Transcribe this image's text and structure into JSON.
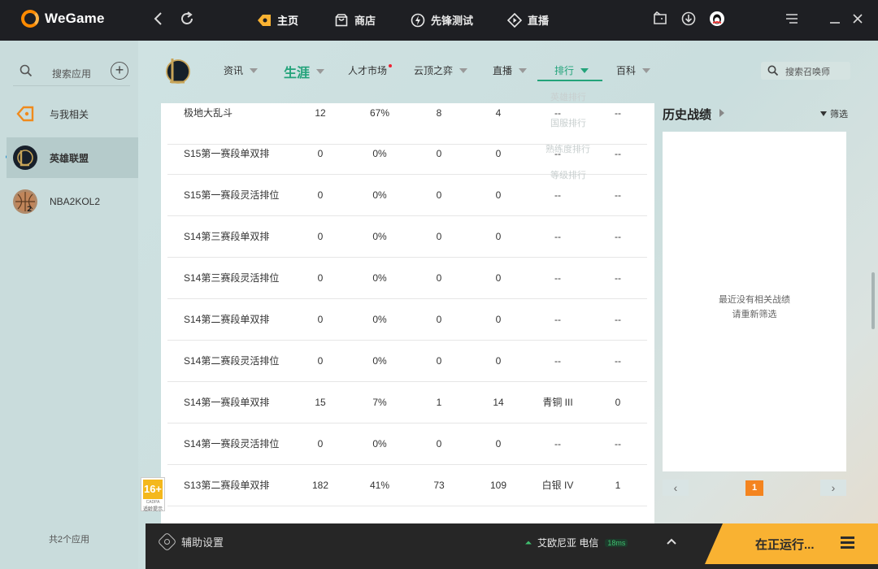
{
  "app": {
    "logo_text": "WeGame"
  },
  "topnav": {
    "items": [
      {
        "label": "主页",
        "icon": "wegame-home-icon"
      },
      {
        "label": "商店",
        "icon": "store-bag-icon"
      },
      {
        "label": "先锋测试",
        "icon": "lightning-test-icon"
      },
      {
        "label": "直播",
        "icon": "live-play-icon"
      }
    ]
  },
  "sidebar": {
    "search_label": "搜索应用",
    "items": [
      {
        "label": "与我相关"
      },
      {
        "label": "英雄联盟"
      },
      {
        "label": "NBA2KOL2"
      }
    ],
    "footer": "共2个应用"
  },
  "subnav": {
    "items": [
      "资讯",
      "生涯",
      "人才市场",
      "云顶之弈",
      "直播",
      "排行",
      "百科"
    ],
    "search_placeholder": "搜索召唤师"
  },
  "rank_menu": {
    "items": [
      "英雄排行",
      "国服排行",
      "熟练度排行",
      "等级排行"
    ]
  },
  "table": {
    "rows": [
      {
        "mode": "极地大乱斗",
        "c1": "12",
        "c2": "67%",
        "c3": "8",
        "c4": "4",
        "c5": "--",
        "c6": "--"
      },
      {
        "mode": "S15第一赛段单双排",
        "c1": "0",
        "c2": "0%",
        "c3": "0",
        "c4": "0",
        "c5": "--",
        "c6": "--"
      },
      {
        "mode": "S15第一赛段灵活排位",
        "c1": "0",
        "c2": "0%",
        "c3": "0",
        "c4": "0",
        "c5": "--",
        "c6": "--"
      },
      {
        "mode": "S14第三赛段单双排",
        "c1": "0",
        "c2": "0%",
        "c3": "0",
        "c4": "0",
        "c5": "--",
        "c6": "--"
      },
      {
        "mode": "S14第三赛段灵活排位",
        "c1": "0",
        "c2": "0%",
        "c3": "0",
        "c4": "0",
        "c5": "--",
        "c6": "--"
      },
      {
        "mode": "S14第二赛段单双排",
        "c1": "0",
        "c2": "0%",
        "c3": "0",
        "c4": "0",
        "c5": "--",
        "c6": "--"
      },
      {
        "mode": "S14第二赛段灵活排位",
        "c1": "0",
        "c2": "0%",
        "c3": "0",
        "c4": "0",
        "c5": "--",
        "c6": "--"
      },
      {
        "mode": "S14第一赛段单双排",
        "c1": "15",
        "c2": "7%",
        "c3": "1",
        "c4": "14",
        "c5": "青铜 III",
        "c6": "0"
      },
      {
        "mode": "S14第一赛段灵活排位",
        "c1": "0",
        "c2": "0%",
        "c3": "0",
        "c4": "0",
        "c5": "--",
        "c6": "--"
      },
      {
        "mode": "S13第二赛段单双排",
        "c1": "182",
        "c2": "41%",
        "c3": "73",
        "c4": "109",
        "c5": "白银 IV",
        "c6": "1"
      }
    ]
  },
  "history": {
    "title": "历史战绩",
    "filter_label": "筛选",
    "empty_line1": "最近没有相关战绩",
    "empty_line2": "请重新筛选",
    "page": "1",
    "prev": "‹",
    "next": "›"
  },
  "age_badge": {
    "rating": "16+",
    "mid": "CADPA",
    "bottom": "适龄提示"
  },
  "bottombar": {
    "assist_label": "辅助设置",
    "server": "艾欧尼亚 电信",
    "ping": "18ms",
    "run_label": "在正运行..."
  },
  "colors": {
    "accent": "#23a37a",
    "orange": "#f9b232",
    "titlebar": "#1e1f23"
  }
}
